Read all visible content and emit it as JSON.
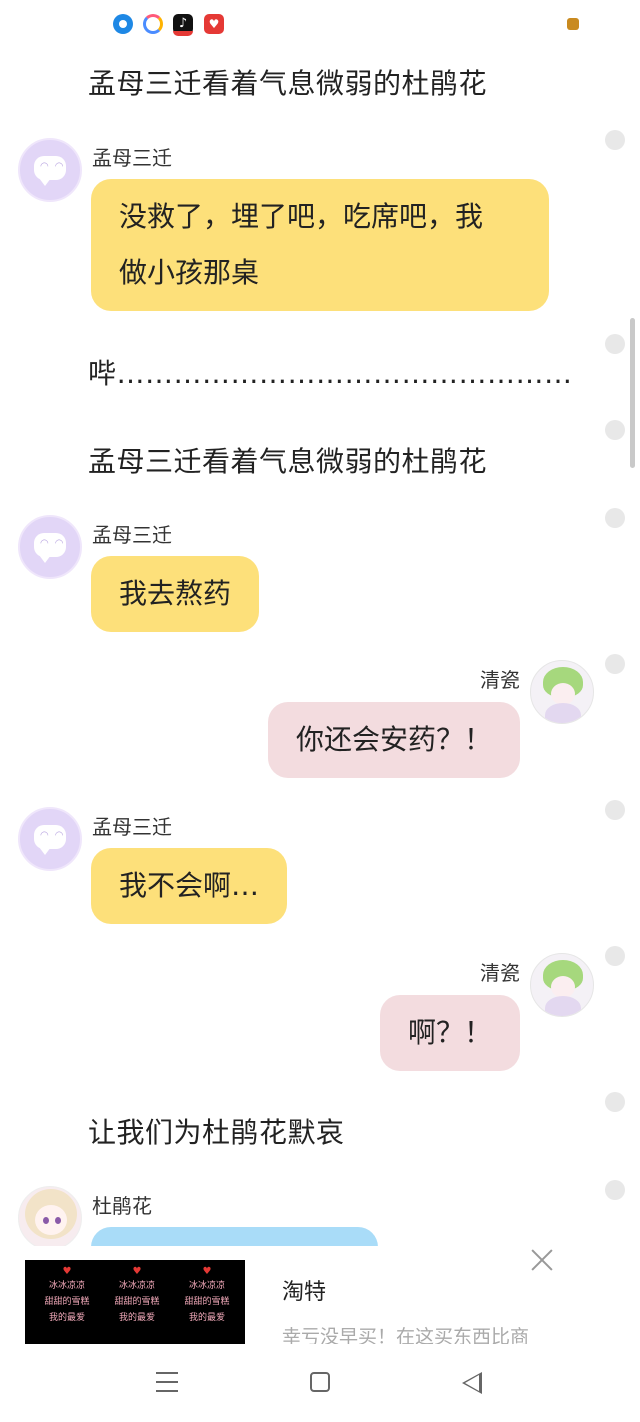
{
  "status_bar": {
    "icons": [
      "location-app-icon",
      "video-app-icon",
      "tiktok-icon",
      "pinduoduo-icon",
      "notification-dot-icon"
    ]
  },
  "chat": {
    "narration_1": "孟母三迁看着气息微弱的杜鹃花",
    "msg_1": {
      "sender": "孟母三迁",
      "lines": [
        "没救了，埋了吧，吃席吧，我",
        "做小孩那桌"
      ]
    },
    "narration_2": "哔…………………………………………",
    "narration_3": "孟母三迁看着气息微弱的杜鹃花",
    "msg_2": {
      "sender": "孟母三迁",
      "text": "我去熬药"
    },
    "msg_3": {
      "sender": "清瓷",
      "text": "你还会安药？！"
    },
    "msg_4": {
      "sender": "孟母三迁",
      "text": "我不会啊…"
    },
    "msg_5": {
      "sender": "清瓷",
      "text": "啊？！"
    },
    "narration_4": "让我们为杜鹃花默哀",
    "msg_6": {
      "sender": "杜鹃花",
      "text": ""
    }
  },
  "ad": {
    "title": "淘特",
    "description": "幸亏没早买！在这买东西比商",
    "thumb_lines": [
      "冰冰凉凉",
      "甜甜的雪糕",
      "我的最爱"
    ]
  },
  "colors": {
    "left_bubble": "#fde07a",
    "right_bubble": "#f3dcdf",
    "partial_bubble": "#a9dcf8"
  }
}
